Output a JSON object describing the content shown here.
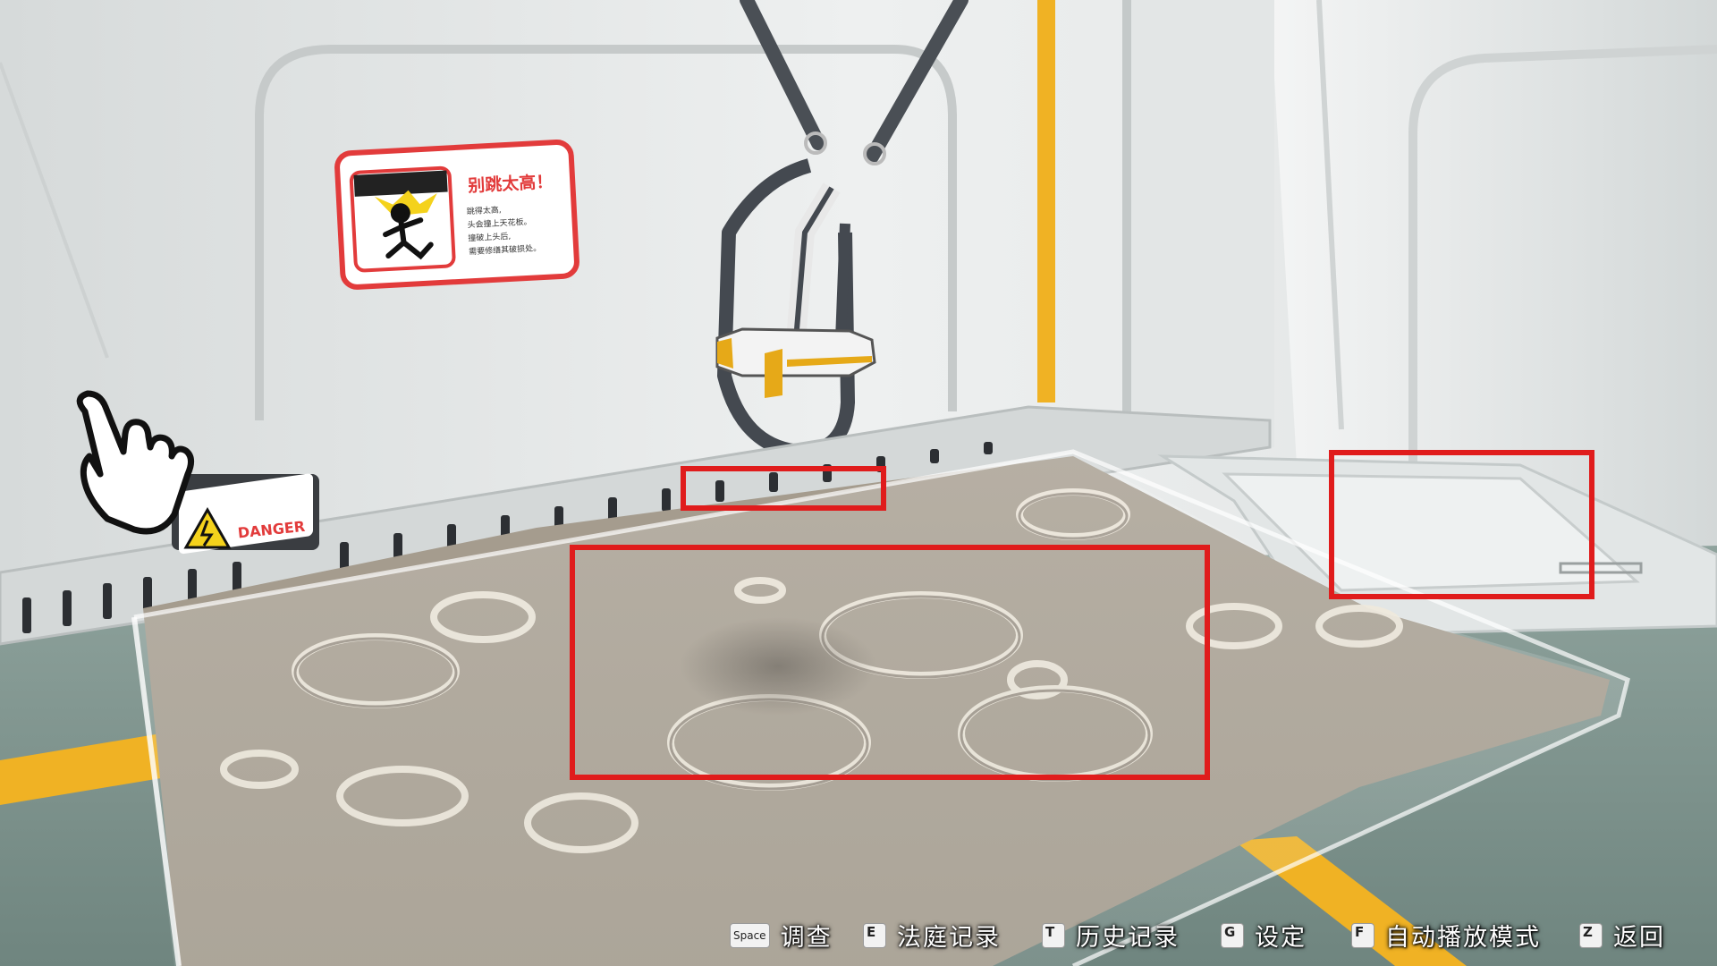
{
  "scene": {
    "sign": {
      "title": "别跳太高！",
      "lines": [
        "跳得太高,",
        "头会撞上天花板。",
        "撞破上头后,",
        "需要修缮其破损处。"
      ]
    },
    "danger_label": "DANGER"
  },
  "hotspots": [
    {
      "name": "vent-grate"
    },
    {
      "name": "moon-surface-shadow"
    },
    {
      "name": "floor-panel"
    }
  ],
  "hint_bar": {
    "items": [
      {
        "key": "Space",
        "label": "调查"
      },
      {
        "key": "E",
        "label": "法庭记录"
      },
      {
        "key": "T",
        "label": "历史记录"
      },
      {
        "key": "G",
        "label": "设定"
      },
      {
        "key": "F",
        "label": "自动播放模式"
      },
      {
        "key": "Z",
        "label": "返回"
      }
    ]
  },
  "colors": {
    "highlight": "#e01c1c",
    "accent_yellow": "#f0b224",
    "wall": "#e8eaea",
    "regolith": "#a59c8e"
  }
}
